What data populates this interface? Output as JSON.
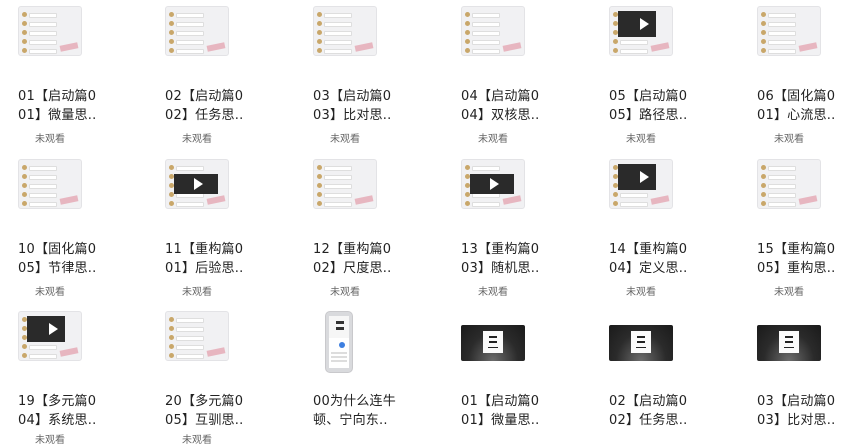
{
  "videos": [
    {
      "line1": "01【启动篇0",
      "line2": "01】微量思..",
      "status": "未观看",
      "thumb": "chat"
    },
    {
      "line1": "02【启动篇0",
      "line2": "02】任务思..",
      "status": "未观看",
      "thumb": "chat"
    },
    {
      "line1": "03【启动篇0",
      "line2": "03】比对思..",
      "status": "未观看",
      "thumb": "chat"
    },
    {
      "line1": "04【启动篇0",
      "line2": "04】双核思..",
      "status": "未观看",
      "thumb": "chat"
    },
    {
      "line1": "05【启动篇0",
      "line2": "05】路径思..",
      "status": "未观看",
      "thumb": "chat-dark"
    },
    {
      "line1": "06【固化篇0",
      "line2": "01】心流思..",
      "status": "未观看",
      "thumb": "chat"
    },
    {
      "line1": "10【固化篇0",
      "line2": "05】节律思..",
      "status": "未观看",
      "thumb": "chat"
    },
    {
      "line1": "11【重构篇0",
      "line2": "01】后验思..",
      "status": "未观看",
      "thumb": "dark-play"
    },
    {
      "line1": "12【重构篇0",
      "line2": "02】尺度思..",
      "status": "未观看",
      "thumb": "chat"
    },
    {
      "line1": "13【重构篇0",
      "line2": "03】随机思..",
      "status": "未观看",
      "thumb": "dark-play"
    },
    {
      "line1": "14【重构篇0",
      "line2": "04】定义思..",
      "status": "未观看",
      "thumb": "chat-dark"
    },
    {
      "line1": "15【重构篇0",
      "line2": "05】重构思..",
      "status": "未观看",
      "thumb": "chat"
    },
    {
      "line1": "19【多元篇0",
      "line2": "04】系统思..",
      "status": "未观看",
      "thumb": "chat-dark"
    },
    {
      "line1": "20【多元篇0",
      "line2": "05】互驯思..",
      "status": "未观看",
      "thumb": "chat"
    },
    {
      "line1": "00为什么连牛",
      "line2": "顿、宁向东..",
      "status": "",
      "thumb": "phone"
    },
    {
      "line1": "01【启动篇0",
      "line2": "01】微量思..",
      "status": "",
      "thumb": "night"
    },
    {
      "line1": "02【启动篇0",
      "line2": "02】任务思..",
      "status": "",
      "thumb": "night"
    },
    {
      "line1": "03【启动篇0",
      "line2": "03】比对思..",
      "status": "",
      "thumb": "night"
    }
  ]
}
